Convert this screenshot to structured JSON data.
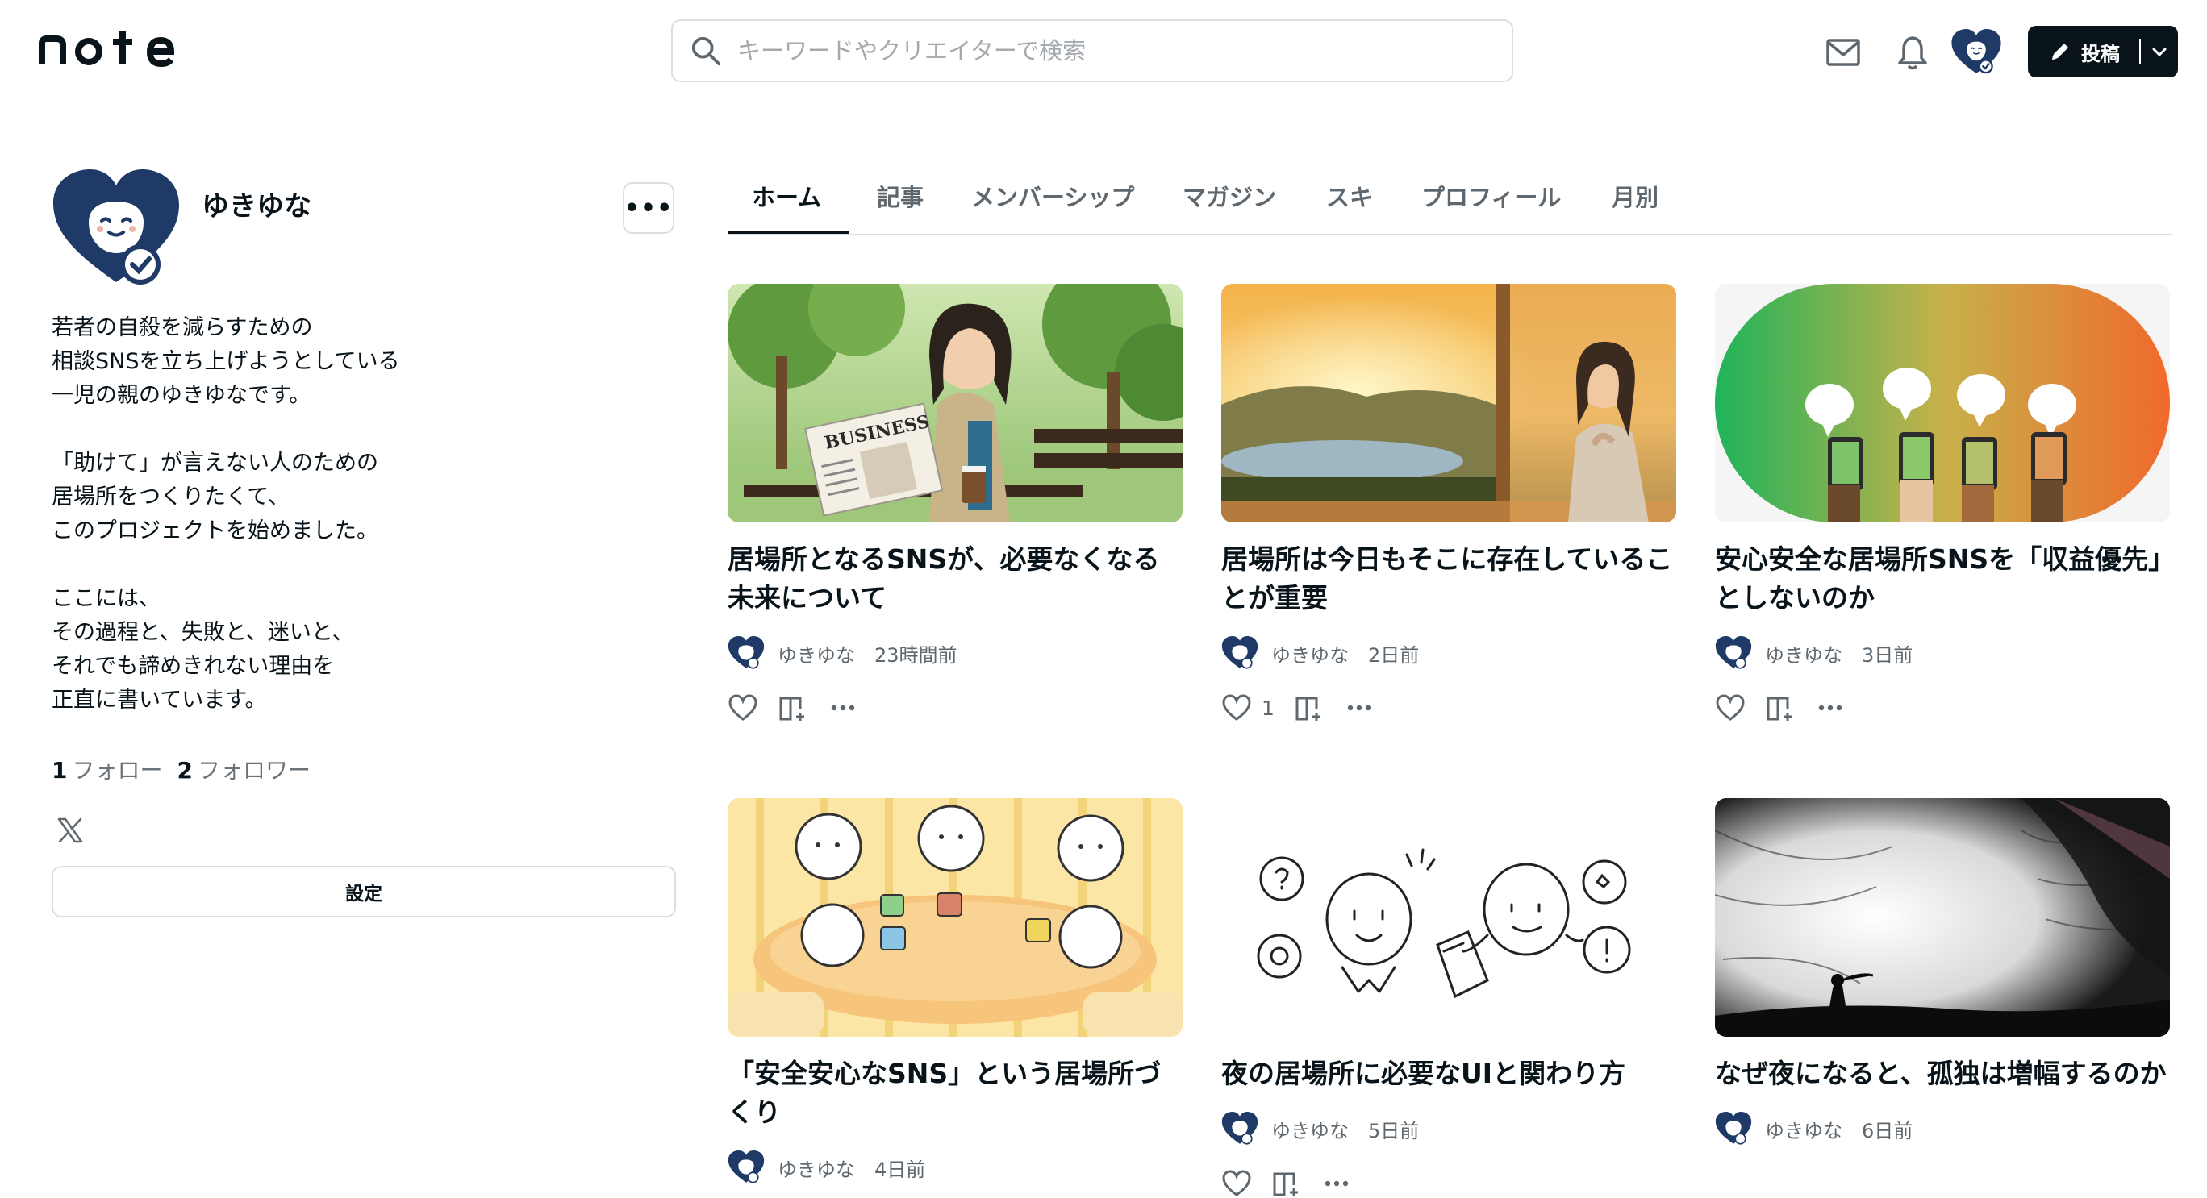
{
  "header": {
    "logo_text": "note",
    "search_placeholder": "キーワードやクリエイターで検索",
    "post_label": "投稿"
  },
  "profile": {
    "name": "ゆきゆな",
    "bio": [
      [
        "若者の自殺を減らすための",
        "相談SNSを立ち上げようとしている",
        "一児の親のゆきゆなです。"
      ],
      [
        "「助けて」が言えない人のための",
        "居場所をつくりたくて、",
        "このプロジェクトを始めました。"
      ],
      [
        "ここには、",
        "その過程と、失敗と、迷いと、",
        "それでも諦めきれない理由を",
        "正直に書いています。"
      ]
    ],
    "follow_count": "1",
    "follow_label": "フォロー",
    "follower_count": "2",
    "follower_label": "フォロワー",
    "settings_label": "設定"
  },
  "tabs": [
    "ホーム",
    "記事",
    "メンバーシップ",
    "マガジン",
    "スキ",
    "プロフィール",
    "月別"
  ],
  "articles": [
    {
      "title": "居場所となるSNSが、必要なくなる未来について",
      "author": "ゆきゆな",
      "time": "23時間前",
      "likes": ""
    },
    {
      "title": "居場所は今日もそこに存在していることが重要",
      "author": "ゆきゆな",
      "time": "2日前",
      "likes": "1"
    },
    {
      "title": "安心安全な居場所SNSを「収益優先」としないのか",
      "author": "ゆきゆな",
      "time": "3日前",
      "likes": ""
    },
    {
      "title": "「安全安心なSNS」という居場所づくり",
      "author": "ゆきゆな",
      "time": "4日前",
      "likes": ""
    },
    {
      "title": "夜の居場所に必要なUIと関わり方",
      "author": "ゆきゆな",
      "time": "5日前",
      "likes": ""
    },
    {
      "title": "なぜ夜になると、孤独は増幅するのか",
      "author": "ゆきゆな",
      "time": "6日前",
      "likes": ""
    }
  ],
  "thumb_texts": {
    "newspaper": "BUSINESS"
  },
  "colors": {
    "brand_dark": "#08131a",
    "avatar_navy": "#1f3a66",
    "muted": "#5e676e",
    "border": "#dcdfe2"
  }
}
